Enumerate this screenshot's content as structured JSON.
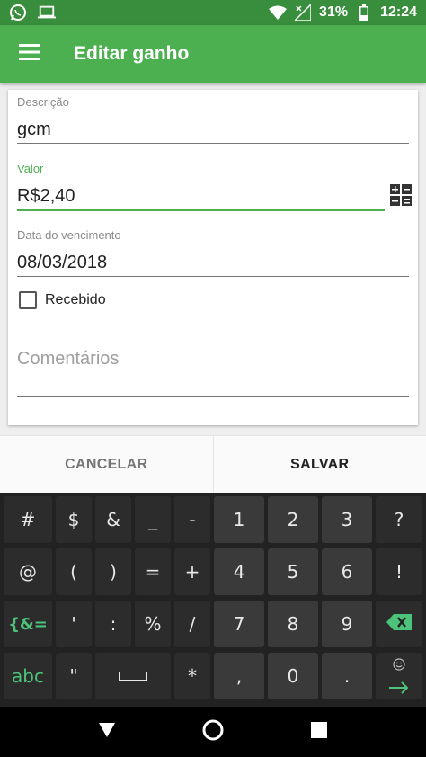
{
  "status_bar": {
    "battery_percent": "31%",
    "time": "12:24",
    "left_icons": [
      "whatsapp-icon",
      "laptop-icon"
    ],
    "right_icons": [
      "wifi-icon",
      "signal-icon",
      "battery-icon"
    ]
  },
  "app_bar": {
    "title": "Editar ganho",
    "menu_icon": "hamburger-menu-icon"
  },
  "form": {
    "description": {
      "label": "Descrição",
      "value": "gcm"
    },
    "amount": {
      "label": "Valor",
      "value": "R$2,40",
      "icon": "calculator-icon",
      "accent": "#4caf50"
    },
    "due_date": {
      "label": "Data do vencimento",
      "value": "08/03/2018"
    },
    "received": {
      "label": "Recebido",
      "checked": false
    },
    "comments": {
      "placeholder": "Comentários",
      "value": ""
    }
  },
  "actions": {
    "cancel_label": "CANCELAR",
    "save_label": "SALVAR"
  },
  "keyboard": {
    "rows": [
      [
        "#",
        "$",
        "&",
        "_",
        "-",
        "1",
        "2",
        "3",
        "?"
      ],
      [
        "@",
        "(",
        ")",
        "=",
        "+",
        "4",
        "5",
        "6",
        "!"
      ],
      [
        "{&=",
        "'",
        ":",
        "%",
        "/",
        "7",
        "8",
        "9",
        "backspace-icon"
      ],
      [
        "abc",
        "\"",
        "space-icon",
        "*",
        ",",
        "0",
        ".",
        "enter-icon"
      ]
    ],
    "accent_color": "#4cc37a"
  },
  "nav_bar": {
    "icons": [
      "back-icon",
      "home-icon",
      "recents-icon"
    ]
  }
}
